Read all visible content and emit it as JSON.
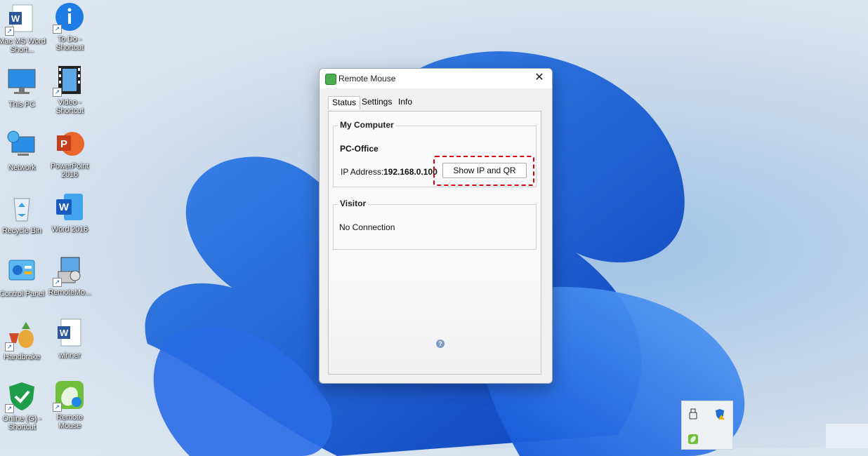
{
  "desktop": {
    "icons": [
      {
        "label": "Mac MS Word Short...",
        "icon": "word-doc-icon"
      },
      {
        "label": "To Do - Shortcut",
        "icon": "todo-info-icon"
      },
      {
        "label": "This PC",
        "icon": "monitor-icon"
      },
      {
        "label": "Video - Shortcut",
        "icon": "video-film-icon"
      },
      {
        "label": "Network",
        "icon": "network-globe-icon"
      },
      {
        "label": "PowerPoint 2016",
        "icon": "powerpoint-icon"
      },
      {
        "label": "Recycle Bin",
        "icon": "recycle-bin-icon"
      },
      {
        "label": "Word 2016",
        "icon": "word-icon"
      },
      {
        "label": "Control Panel",
        "icon": "control-panel-icon"
      },
      {
        "label": "RemoteMo...",
        "icon": "installer-icon"
      },
      {
        "label": "Handbrake",
        "icon": "handbrake-icon"
      },
      {
        "label": "winner",
        "icon": "word-doc-icon"
      },
      {
        "label": "Online (G) - Shortcut",
        "icon": "shield-check-icon"
      },
      {
        "label": "Remote Mouse",
        "icon": "remote-mouse-icon"
      }
    ]
  },
  "window": {
    "title": "Remote Mouse",
    "close_glyph": "✕",
    "tabs": [
      {
        "label": "Status",
        "active": true
      },
      {
        "label": "Settings",
        "active": false
      },
      {
        "label": "Info",
        "active": false
      }
    ],
    "my_computer": {
      "legend": "My Computer",
      "pc_name": "PC-Office",
      "ip_label": "IP Address:",
      "ip_value": "192.168.0.100",
      "show_button": "Show IP and QR"
    },
    "visitor": {
      "legend": "Visitor",
      "status": "No Connection"
    },
    "help_glyph": "?"
  },
  "tray": {
    "icons": [
      "usb-drive-icon",
      "security-warning-icon",
      "remote-mouse-tray-icon"
    ]
  },
  "colors": {
    "highlight": "#d8000c",
    "accent": "#1a5fb4"
  }
}
